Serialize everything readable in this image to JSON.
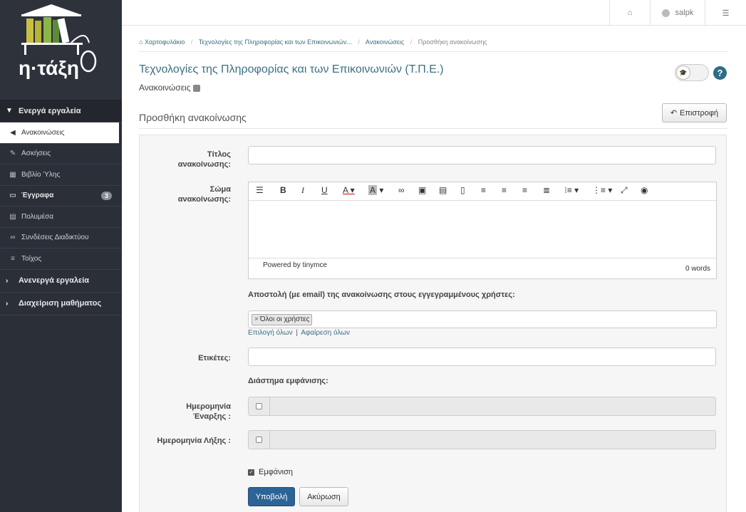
{
  "logo": {
    "text": "η·τάξη"
  },
  "topbar": {
    "home_icon": "home-icon",
    "username": "salpk",
    "settings_icon": "sliders-icon"
  },
  "sidebar": {
    "sections": [
      {
        "label": "Ενεργά εργαλεία",
        "open": true
      },
      {
        "label": "Ανενεργά εργαλεία",
        "open": false
      },
      {
        "label": "Διαχείριση μαθήματος",
        "open": false
      }
    ],
    "tools": [
      {
        "label": "Ανακοινώσεις",
        "icon": "megaphone-icon",
        "active": true
      },
      {
        "label": "Ασκήσεις",
        "icon": "pencil-icon"
      },
      {
        "label": "Βιβλίο Ύλης",
        "icon": "calendar-icon"
      },
      {
        "label": "Έγγραφα",
        "icon": "folder-icon",
        "badge": "3"
      },
      {
        "label": "Πολυμέσα",
        "icon": "film-icon"
      },
      {
        "label": "Συνδέσεις Διαδικτύου",
        "icon": "link-icon"
      },
      {
        "label": "Τοίχος",
        "icon": "list-icon"
      }
    ]
  },
  "breadcrumb": {
    "home": "Χαρτοφυλάκιο",
    "course": "Τεχνολογίες της Πληροφορίας και των Επικοινωνιών...",
    "section": "Ανακοινώσεις",
    "current": "Προσθήκη ανακοίνωσης"
  },
  "course_title": "Τεχνολογίες της Πληροφορίας και των Επικοινωνιών (Τ.Π.Ε.)",
  "page_subtitle": "Ανακοινώσεις",
  "form": {
    "title": "Προσθήκη ανακοίνωσης",
    "back_label": "Επιστροφή",
    "title_label_1": "Τίτλος",
    "title_label_2": "ανακοίνωσης:",
    "title_value": "",
    "body_label_1": "Σώμα",
    "body_label_2": "ανακοίνωσης:",
    "powered_by": "Powered by tinymce",
    "word_count": "0 words",
    "email_label": "Αποστολή (με email) της ανακοίνωσης στους εγγεγραμμένους χρήστες:",
    "recipient_chip": "Όλοι οι χρήστες",
    "select_all": "Επιλογή όλων",
    "link_sep": "|",
    "remove_all": "Αφαίρεση όλων",
    "tags_label": "Ετικέτες:",
    "tags_value": "",
    "display_period": "Διάστημα εμφάνισης:",
    "start_label_1": "Ημερομηνία",
    "start_label_2": "Έναρξης :",
    "end_label": "Ημερομηνία Λήξης :",
    "visible_label": "Εμφάνιση",
    "submit_label": "Υποβολή",
    "cancel_label": "Ακύρωση"
  }
}
